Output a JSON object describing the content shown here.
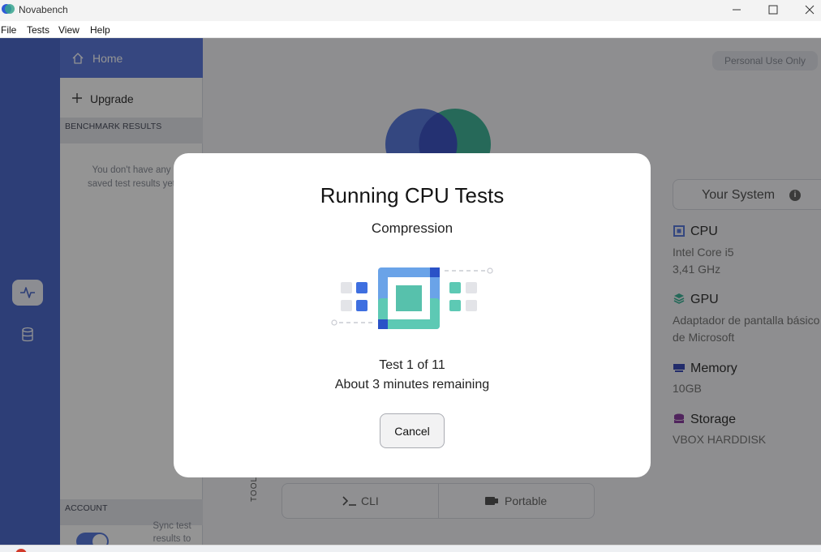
{
  "window": {
    "title": "Novabench"
  },
  "menu": [
    "File",
    "Tests",
    "View",
    "Help"
  ],
  "sidebar": {
    "home_label": "Home",
    "upgrade_label": "Upgrade",
    "benchmark_header": "BENCHMARK RESULTS",
    "empty_results": "You don't have any saved test results yet",
    "account_header": "ACCOUNT",
    "sync_text": "Sync test results to"
  },
  "rail": {
    "items": [
      "activity-icon",
      "database-icon"
    ]
  },
  "main": {
    "license_badge": "Personal Use Only",
    "your_system_label": "Your System",
    "specs": [
      {
        "title": "CPU",
        "value": "Intel Core i5",
        "value2": "3,41 GHz",
        "icon": "cpu-icon",
        "color": "#5b7bdc"
      },
      {
        "title": "GPU",
        "value": "Adaptador de pantalla básico",
        "value2": "de Microsoft",
        "icon": "gpu-icon",
        "color": "#3fb59a"
      },
      {
        "title": "Memory",
        "value": "10GB",
        "icon": "memory-icon",
        "color": "#3b4db8"
      },
      {
        "title": "Storage",
        "value": "VBOX HARDDISK",
        "icon": "storage-icon",
        "color": "#8a3fa0"
      }
    ],
    "tools_label": "TOOLS",
    "tools": [
      {
        "label": "CLI",
        "icon": "terminal-icon"
      },
      {
        "label": "Portable",
        "icon": "usb-drive-icon"
      }
    ]
  },
  "modal": {
    "title": "Running CPU Tests",
    "subtitle": "Compression",
    "progress": "Test 1 of 11",
    "remaining": "About 3 minutes remaining",
    "cancel_label": "Cancel"
  },
  "colors": {
    "accent": "#5d7bdc",
    "teal": "#3fb59a"
  }
}
